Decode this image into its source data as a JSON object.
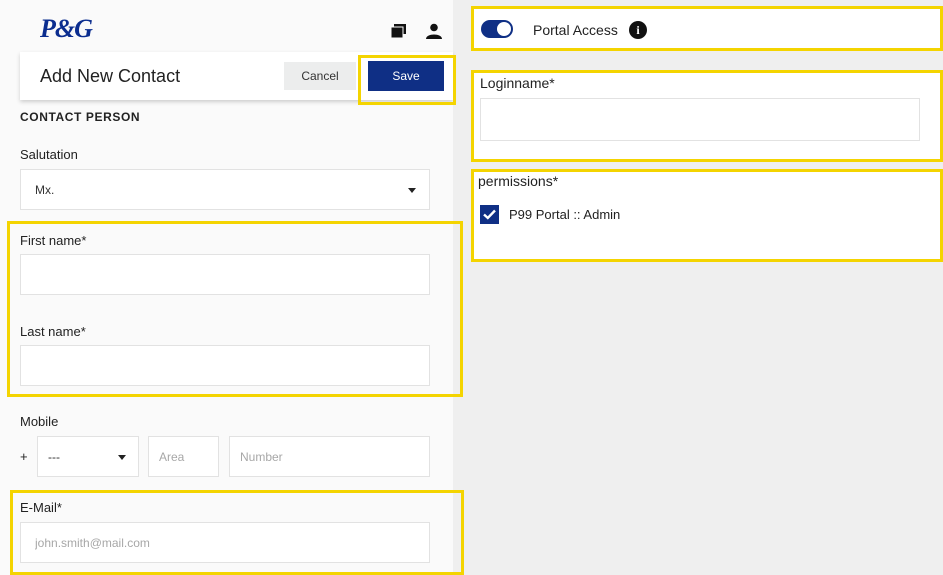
{
  "brand": {
    "logo_text": "P&G"
  },
  "header": {
    "title": "Add New Contact",
    "cancel_label": "Cancel",
    "save_label": "Save"
  },
  "icons": {
    "top_right": [
      "layers-icon",
      "user-icon"
    ],
    "info": "info-icon",
    "caret": "chevron-down-icon",
    "check": "checkmark-icon"
  },
  "contact": {
    "section_title": "CONTACT PERSON",
    "salutation": {
      "label": "Salutation",
      "value": "Mx."
    },
    "first_name": {
      "label": "First name*",
      "value": ""
    },
    "last_name": {
      "label": "Last name*",
      "value": ""
    },
    "mobile": {
      "label": "Mobile",
      "prefix": "+",
      "country_code": "---",
      "area_placeholder": "Area",
      "number_placeholder": "Number"
    },
    "email": {
      "label": "E-Mail*",
      "placeholder": "john.smith@mail.com"
    }
  },
  "portal": {
    "toggle_label": "Portal Access",
    "toggle_on": true,
    "info_glyph": "i",
    "loginname_label": "Loginname*",
    "loginname_value": "",
    "permissions_label": "permissions*",
    "permissions": [
      {
        "label": "P99 Portal :: Admin",
        "checked": true
      }
    ]
  },
  "colors": {
    "accent": "#0f2f85",
    "highlight": "#f4d400"
  }
}
